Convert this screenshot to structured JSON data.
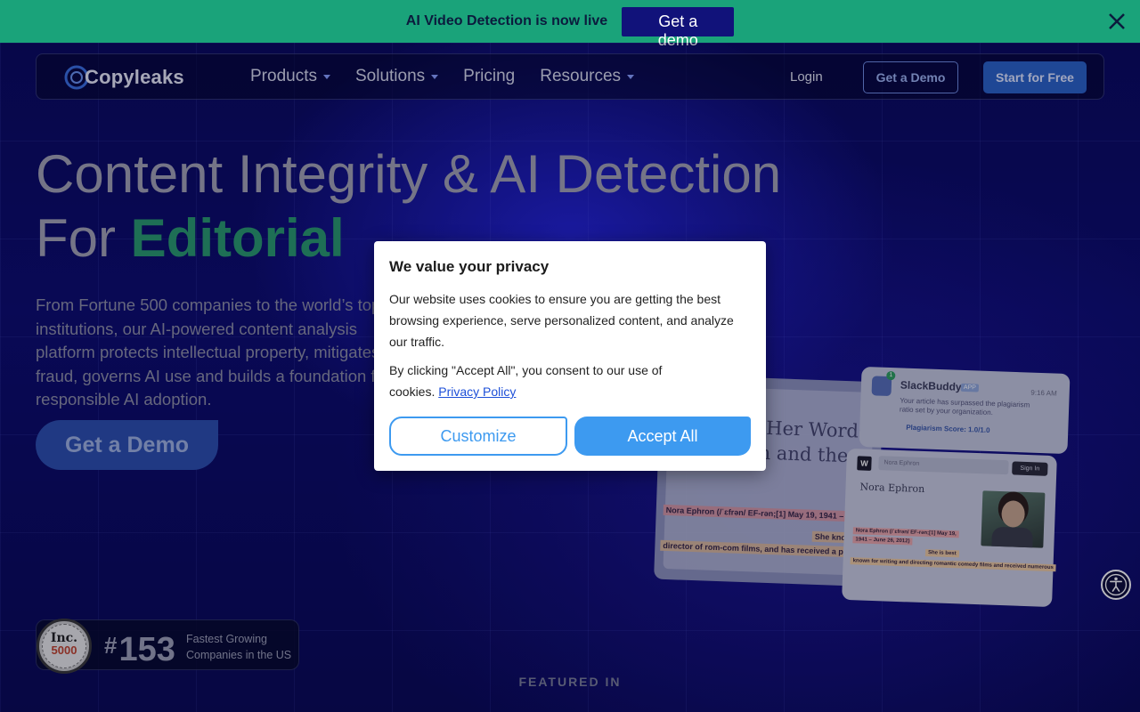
{
  "announcement": {
    "text": "AI Video Detection is now live",
    "button_label": "Get a demo"
  },
  "nav": {
    "logo_text": "Copyleaks",
    "links": [
      {
        "label": "Products"
      },
      {
        "label": "Solutions"
      },
      {
        "label": "Pricing"
      },
      {
        "label": "Resources"
      }
    ],
    "login_label": "Login",
    "demo_label": "Get a Demo",
    "start_label": "Start for Free"
  },
  "hero": {
    "title_line1": "Content Integrity & AI Detection",
    "title_prefix": "For",
    "title_accent": "Editorial",
    "description": "From Fortune 500 companies to the world’s top institutions, our AI-powered content analysis platform protects intellectual property, mitigates fraud, governs AI use and builds a foundation for responsible AI adoption.",
    "cta_label": "Get a Demo"
  },
  "illustration": {
    "doc_headline": "n Her Words\non and the",
    "doc_highlights": [
      "Nora Ephron (/ˈɛfrən/ EF-rən;[1] May 19, 1941 – June",
      "She know",
      "director of rom-com films, and has received a plethora"
    ],
    "slack": {
      "title": "SlackBuddy",
      "app_tag": "APP",
      "time": "9:16 AM",
      "badge": "1",
      "body": "Your article has surpassed the plagiarism ratio set by your organization.",
      "score": "Plagiarism Score: 1.0/1.0"
    },
    "wiki": {
      "logo": "W",
      "search_text": "Nora Ephron",
      "signin": "Sign In",
      "name": "Nora Ephron",
      "highlights": [
        "Nora Ephron (/ˈɛfrən/ EF-rən;[1] May 19,",
        "1941 – June 26, 2012)",
        "She is best",
        "known for writing and directing romantic comedy films and received numerous"
      ]
    }
  },
  "inc_badge": {
    "seal_word": "Inc.",
    "seal_number": "5000",
    "rank_hash": "#",
    "rank": "153",
    "text": "Fastest Growing Companies in the US"
  },
  "featured_label": "FEATURED IN",
  "cookie_modal": {
    "title": "We value your privacy",
    "paragraph1": "Our website uses cookies to ensure you are getting the best browsing experience, serve personalized content, and analyze our traffic.",
    "paragraph2_prefix": "By clicking \"Accept All\", you consent to our use of cookies.",
    "policy_link": "Privacy Policy",
    "customize_label": "Customize",
    "accept_label": "Accept All"
  },
  "colors": {
    "announcement_bg": "#1aa37a",
    "accent_green": "#2a9a6e",
    "modal_button_blue": "#3d9af0"
  },
  "icons": [
    "close-icon",
    "chevron-down-icon",
    "accessibility-icon",
    "copyleaks-logo-icon"
  ]
}
